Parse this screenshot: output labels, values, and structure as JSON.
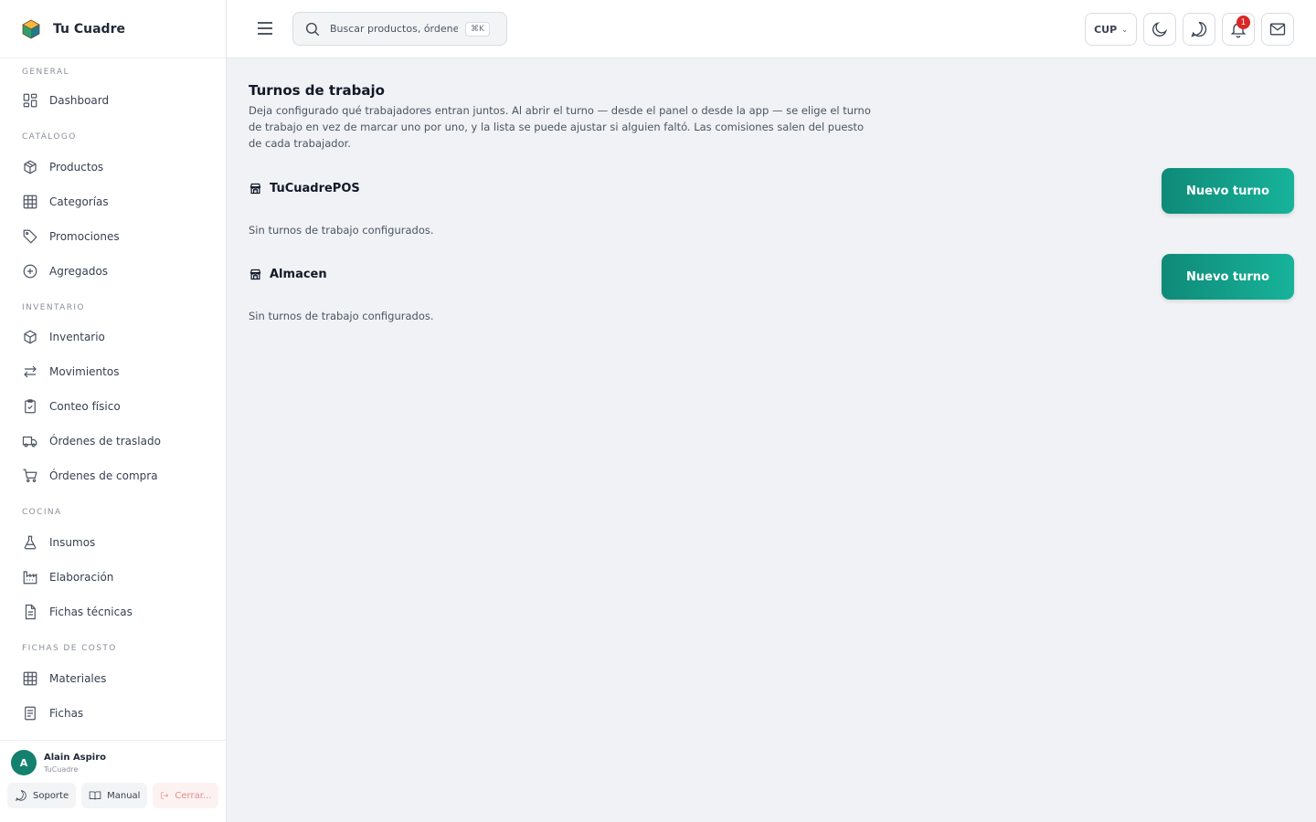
{
  "brand": {
    "name": "Tu Cuadre"
  },
  "sidebar": {
    "sections": [
      {
        "title": "GENERAL",
        "items": [
          {
            "label": "Dashboard"
          }
        ]
      },
      {
        "title": "CATÁLOGO",
        "items": [
          {
            "label": "Productos"
          },
          {
            "label": "Categorías"
          },
          {
            "label": "Promociones"
          },
          {
            "label": "Agregados"
          }
        ]
      },
      {
        "title": "INVENTARIO",
        "items": [
          {
            "label": "Inventario"
          },
          {
            "label": "Movimientos"
          },
          {
            "label": "Conteo físico"
          },
          {
            "label": "Órdenes de traslado"
          },
          {
            "label": "Órdenes de compra"
          }
        ]
      },
      {
        "title": "COCINA",
        "items": [
          {
            "label": "Insumos"
          },
          {
            "label": "Elaboración"
          },
          {
            "label": "Fichas técnicas"
          }
        ]
      },
      {
        "title": "FICHAS DE COSTO",
        "items": [
          {
            "label": "Materiales"
          },
          {
            "label": "Fichas"
          }
        ]
      }
    ]
  },
  "user": {
    "initial": "A",
    "name": "Alain Aspiro",
    "org": "TuCuadre",
    "support_label": "Soporte",
    "manual_label": "Manual",
    "logout_label": "Cerrar..."
  },
  "topbar": {
    "search_placeholder": "Buscar productos, órdenes",
    "shortcut": "⌘K",
    "currency": "CUP",
    "notification_count": "1"
  },
  "page": {
    "title": "Turnos de trabajo",
    "description": "Deja configurado qué trabajadores entran juntos. Al abrir el turno — desde el panel o desde la app — se elige el turno de trabajo en vez de marcar uno por uno, y la lista se puede ajustar si alguien faltó. Las comisiones salen del puesto de cada trabajador.",
    "stores": [
      {
        "name": "TuCuadrePOS",
        "button_label": "Nuevo turno",
        "empty_text": "Sin turnos de trabajo configurados."
      },
      {
        "name": "Almacen",
        "button_label": "Nuevo turno",
        "empty_text": "Sin turnos de trabajo configurados."
      }
    ]
  },
  "colors": {
    "accent": "#14806e",
    "accent_light": "#17b39a",
    "badge": "#dc2626"
  }
}
